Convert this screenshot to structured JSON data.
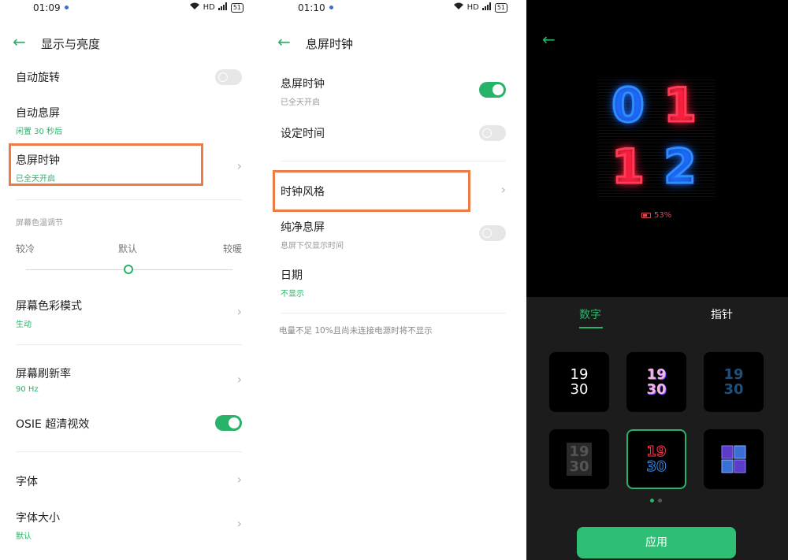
{
  "panel1": {
    "status": {
      "time": "01:09",
      "net": "HD",
      "battery": "51"
    },
    "header": {
      "title": "显示与亮度"
    },
    "rows": {
      "auto_rotate": {
        "title": "自动旋转"
      },
      "auto_lock": {
        "title": "自动息屏",
        "sub": "闲置 30 秒后"
      },
      "aod": {
        "title": "息屏时钟",
        "sub": "已全天开启"
      },
      "color_temp_label": "屏幕色温调节",
      "slider": {
        "cool": "较冷",
        "default": "默认",
        "warm": "较暖",
        "level": 0.5
      },
      "color_mode": {
        "title": "屏幕色彩模式",
        "sub": "生动"
      },
      "refresh": {
        "title": "屏幕刷新率",
        "sub": "90 Hz"
      },
      "osie": {
        "title": "OSIE 超清视效"
      },
      "font": {
        "title": "字体"
      },
      "font_size": {
        "title": "字体大小",
        "sub": "默认"
      }
    }
  },
  "panel2": {
    "status": {
      "time": "01:10",
      "net": "HD",
      "battery": "51"
    },
    "header": {
      "title": "息屏时钟"
    },
    "rows": {
      "aod": {
        "title": "息屏时钟",
        "sub": "已全天开启"
      },
      "schedule": {
        "title": "设定时间"
      },
      "clock_style": {
        "title": "时钟风格"
      },
      "pure": {
        "title": "纯净息屏",
        "sub": "息屏下仅显示时间"
      },
      "date": {
        "title": "日期",
        "sub": "不显示"
      }
    },
    "footnote": "电量不足 10%且尚未连接电源时将不显示"
  },
  "panel3": {
    "clock": {
      "d1": "0",
      "d2": "1",
      "d3": "1",
      "d4": "2"
    },
    "battery": "53%",
    "tabs": {
      "digital": "数字",
      "analog": "指针"
    },
    "tiles": [
      {
        "top": "19",
        "bottom": "30"
      },
      {
        "top": "19",
        "bottom": "30"
      },
      {
        "top": "19",
        "bottom": "30"
      },
      {
        "top": "19",
        "bottom": "30"
      },
      {
        "top": "19",
        "bottom": "30"
      },
      {
        "top": "",
        "bottom": ""
      }
    ],
    "apply": "应用"
  },
  "colors": {
    "accent": "#2ab36a",
    "highlight": "#ee7b45"
  }
}
